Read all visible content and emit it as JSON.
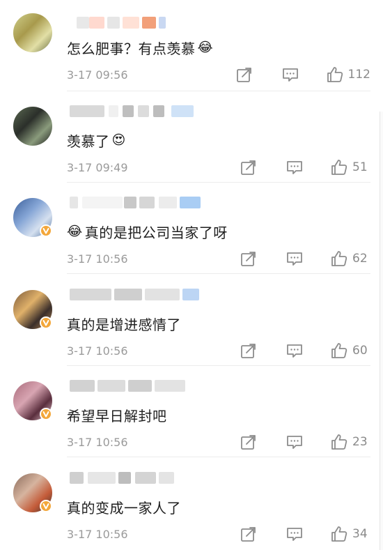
{
  "comments": [
    {
      "text": "怎么肥事？有点羡慕",
      "emoji": "😂",
      "emoji_name": "laughing-tears-icon",
      "time": "3-17 09:56",
      "likes": "112",
      "verified": false,
      "avatar_colors": [
        "#cfcf8c",
        "#a89a4c",
        "#e2dfa6",
        "#6a6f40"
      ]
    },
    {
      "text": "羡慕了",
      "emoji": "😍",
      "emoji_name": "heart-eyes-icon",
      "time": "3-17 09:49",
      "likes": "51",
      "verified": false,
      "avatar_colors": [
        "#5b6a52",
        "#2b2f2a",
        "#8a9b7c",
        "#1c1d1c"
      ]
    },
    {
      "text": "真的是把公司当家了呀",
      "emoji": "😂",
      "emoji_name": "laughing-tears-icon",
      "emoji_first": true,
      "time": "3-17 10:56",
      "likes": "62",
      "verified": true,
      "avatar_colors": [
        "#3b5f9a",
        "#86a6d6",
        "#d5e0ef",
        "#4a6e9f"
      ]
    },
    {
      "text": "真的是增进感情了",
      "emoji": "",
      "time": "3-17 10:56",
      "likes": "60",
      "verified": true,
      "avatar_colors": [
        "#7b5a3a",
        "#e0b16a",
        "#3a2e2a",
        "#b98a55"
      ]
    },
    {
      "text": "希望早日解封吧",
      "emoji": "",
      "time": "3-17 10:56",
      "likes": "23",
      "verified": true,
      "avatar_colors": [
        "#a96a7a",
        "#d8a5b2",
        "#5a2e3d",
        "#e9c9d1"
      ]
    },
    {
      "text": "真的变成一家人了",
      "emoji": "",
      "time": "3-17 10:56",
      "likes": "34",
      "verified": true,
      "avatar_colors": [
        "#8a6a5a",
        "#d6b49f",
        "#c45c3a",
        "#3e2f29"
      ]
    }
  ],
  "colors": {
    "verified_badge": "#f3a73b",
    "text": "#1f1f1f",
    "meta": "#9a9a9a"
  },
  "icons": {
    "repost": "share-icon",
    "reply": "comment-icon",
    "like": "thumbs-up-icon"
  }
}
